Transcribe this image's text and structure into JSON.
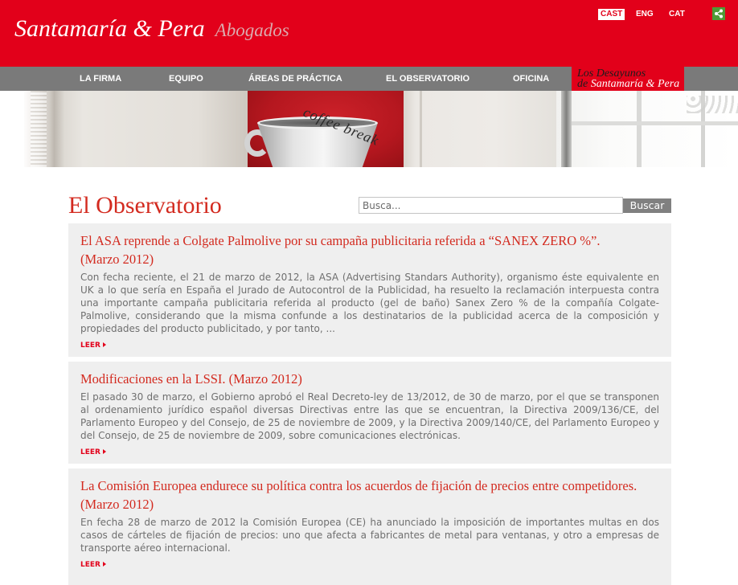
{
  "header": {
    "logo_name": "Santamaría & Pera",
    "logo_suffix": "Abogados",
    "languages": [
      {
        "label": "CAST",
        "active": true
      },
      {
        "label": "ENG",
        "active": false
      },
      {
        "label": "CAT",
        "active": false
      }
    ],
    "share_icon": "share-icon"
  },
  "nav": {
    "items": [
      {
        "label": "LA FIRMA"
      },
      {
        "label": "EQUIPO"
      },
      {
        "label": "ÁREAS DE PRÁCTICA"
      },
      {
        "label": "EL OBSERVATORIO"
      },
      {
        "label": "OFICINA"
      }
    ],
    "featured": {
      "line1": "Los Desayunos",
      "line2_prefix": "de",
      "line2_brand": "Santamaría & Pera"
    }
  },
  "hero": {
    "poster_text": "coffee break"
  },
  "main": {
    "title": "El Observatorio",
    "search": {
      "placeholder": "Busca...",
      "button_label": "Buscar"
    },
    "articles": [
      {
        "title": "El ASA reprende a Colgate Palmolive por su campaña publicitaria referida a “SANEX ZERO %”.",
        "date": "(Marzo 2012)",
        "excerpt": "Con fecha reciente, el 21 de marzo de 2012, la ASA (Advertising Standars Authority), organismo éste equivalente en UK a lo que sería en España el Jurado de Autocontrol de la Publicidad, ha resuelto la reclamación interpuesta contra una importante campaña publicitaria referida al producto (gel de baño) Sanex Zero % de la compañía Colgate-Palmolive, considerando que la misma confunde a los destinatarios de la publicidad acerca de la composición y propiedades del producto publicitado, y por tanto, ...",
        "read_more": "LEER"
      },
      {
        "title": "Modificaciones en la LSSI.",
        "date": "(Marzo 2012)",
        "excerpt": "El pasado 30 de marzo, el Gobierno aprobó el Real Decreto-ley de 13/2012, de 30 de marzo, por el que se transponen al ordenamiento jurídico español diversas Directivas entre las que se encuentran, la Directiva 2009/136/CE, del Parlamento Europeo y del Consejo, de 25 de noviembre de 2009, y la Directiva 2009/140/CE, del Parlamento Europeo y del Consejo, de 25 de noviembre de 2009, sobre comunicaciones electrónicas.",
        "read_more": "LEER"
      },
      {
        "title": "La Comisión Europea endurece su política contra los acuerdos de fijación de precios entre competidores.",
        "date": "(Marzo 2012)",
        "excerpt": "En fecha 28 de marzo de 2012 la Comisión Europea (CE) ha anunciado la imposición de importantes multas en dos casos de cárteles de fijación de precios: uno que afecta a fabricantes de metal para ventanas, y otro a empresas de transporte aéreo internacional.",
        "read_more": "LEER"
      }
    ]
  },
  "icons": {
    "share": "share-icon",
    "read_more_arrow": "arrow-right-icon"
  },
  "colors": {
    "brand_red": "#e2001a",
    "nav_gray": "#7a7a7a",
    "title_red": "#d32a1f",
    "article_background": "#efefef",
    "body_text": "#6f6f6f",
    "share_green": "#4f9a36",
    "button_gray": "#808080"
  }
}
